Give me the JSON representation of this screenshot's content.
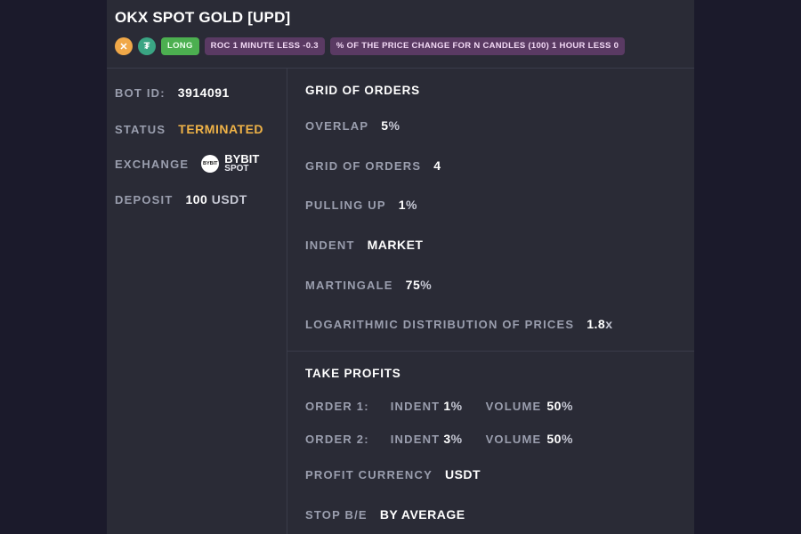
{
  "bot": {
    "title": "OKX SPOT GOLD [UPD]",
    "coins": [
      {
        "icon": "x-coin-icon",
        "glyph": "✕",
        "color": "#f0a848"
      },
      {
        "icon": "tether-icon",
        "glyph": "₮",
        "color": "#3aa583"
      }
    ],
    "direction": "LONG",
    "conditions": [
      "ROC 1 MINUTE LESS -0.3",
      "% OF THE PRICE CHANGE FOR N CANDLES (100) 1 HOUR LESS 0"
    ]
  },
  "info": {
    "bot_id_label": "BOT ID:",
    "bot_id": "3914091",
    "status_label": "STATUS",
    "status": "TERMINATED",
    "status_color": "#f0b347",
    "exchange_label": "EXCHANGE",
    "exchange_logo_text": "BYBIT",
    "exchange_name": "BYBIT",
    "exchange_market": "SPOT",
    "deposit_label": "DEPOSIT",
    "deposit_amount": "100",
    "deposit_currency": "USDT"
  },
  "grid": {
    "title": "GRID OF ORDERS",
    "overlap_label": "OVERLAP",
    "overlap_value": "5",
    "overlap_unit": "%",
    "grid_label": "GRID OF ORDERS",
    "grid_value": "4",
    "pulling_label": "PULLING UP",
    "pulling_value": "1",
    "pulling_unit": "%",
    "indent_label": "INDENT",
    "indent_value": "MARKET",
    "martingale_label": "MARTINGALE",
    "martingale_value": "75",
    "martingale_unit": "%",
    "log_label": "LOGARITHMIC DISTRIBUTION OF PRICES",
    "log_value": "1.8",
    "log_unit": "x"
  },
  "take_profits": {
    "title": "TAKE PROFITS",
    "orders": [
      {
        "label": "ORDER 1:",
        "indent_label": "INDENT",
        "indent_value": "1",
        "indent_unit": "%",
        "volume_label": "VOLUME",
        "volume_value": "50",
        "volume_unit": "%"
      },
      {
        "label": "ORDER 2:",
        "indent_label": "INDENT",
        "indent_value": "3",
        "indent_unit": "%",
        "volume_label": "VOLUME",
        "volume_value": "50",
        "volume_unit": "%"
      }
    ],
    "currency_label": "PROFIT CURRENCY",
    "currency_value": "USDT",
    "stop_label": "STOP B/E",
    "stop_value": "BY AVERAGE"
  }
}
